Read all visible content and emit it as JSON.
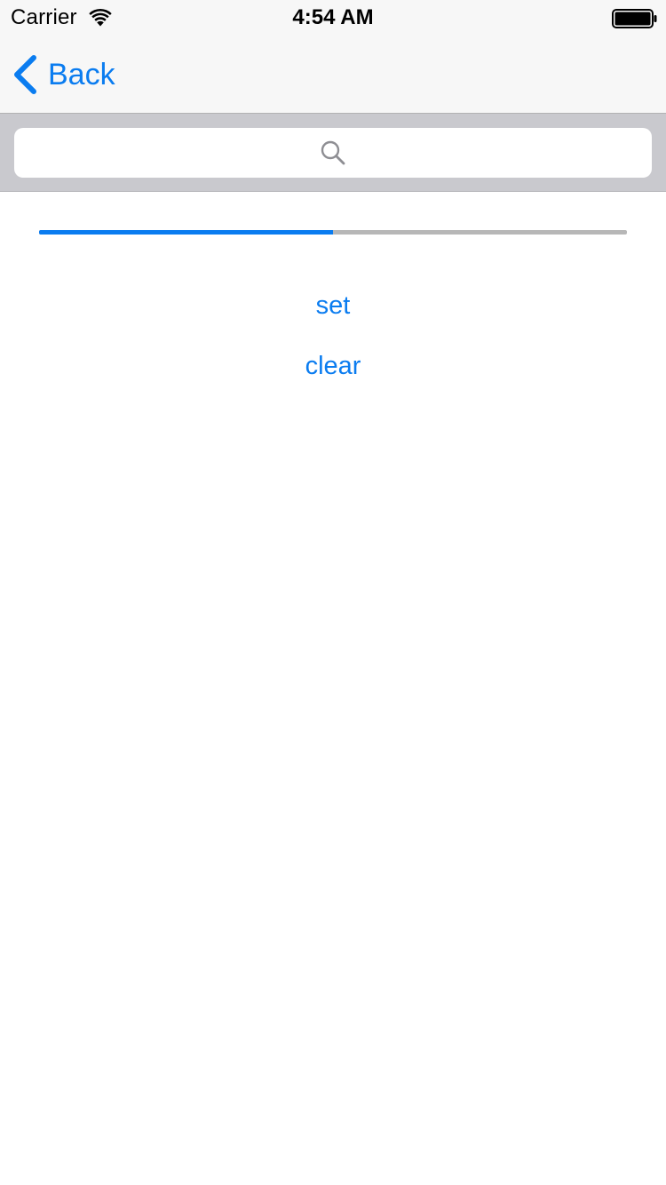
{
  "status_bar": {
    "carrier": "Carrier",
    "time": "4:54 AM",
    "wifi_icon": "wifi-icon",
    "battery_icon": "battery-full-icon"
  },
  "nav": {
    "back_label": "Back",
    "back_icon": "chevron-left-icon"
  },
  "search": {
    "placeholder": "",
    "value": "",
    "icon": "search-icon"
  },
  "progress": {
    "value": 0.5
  },
  "actions": {
    "set_label": "set",
    "clear_label": "clear"
  },
  "colors": {
    "accent": "#0a7cf0",
    "bar_background": "#f7f7f7",
    "search_bar_background": "#c9c9ce",
    "progress_track": "#b7b7b7"
  }
}
